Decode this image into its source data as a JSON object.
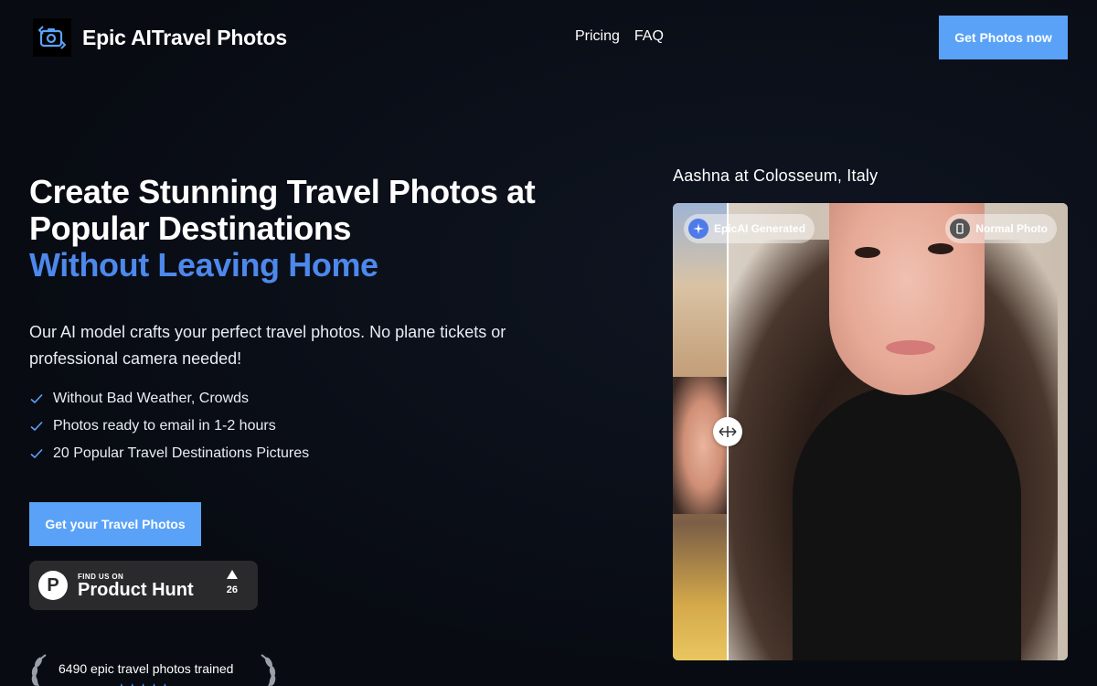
{
  "header": {
    "brand": "Epic AITravel Photos",
    "nav": [
      {
        "label": "Pricing"
      },
      {
        "label": "FAQ"
      }
    ],
    "cta_label": "Get Photos now"
  },
  "hero": {
    "title_line1": "Create Stunning Travel Photos at",
    "title_line2": "Popular Destinations",
    "title_accent": "Without Leaving Home",
    "lead": "Our AI model crafts your perfect travel photos. No plane tickets or professional camera needed!",
    "features": [
      {
        "label": "Without Bad Weather, Crowds"
      },
      {
        "label": "Photos ready to email in 1-2 hours"
      },
      {
        "label": "20 Popular Travel Destinations Pictures"
      }
    ],
    "cta_label": "Get your Travel Photos",
    "product_hunt": {
      "small": "FIND US ON",
      "big": "Product Hunt",
      "letter": "P",
      "votes": "26"
    },
    "trained_text": "6490 epic travel photos trained",
    "rating_stars": "★★★★★"
  },
  "showcase": {
    "caption": "Aashna at Colosseum, Italy",
    "badge_ai": "EpicAI Generated",
    "badge_normal": "Normal Photo"
  },
  "colors": {
    "accent": "#5aa2f7",
    "title_accent": "#4d88ec",
    "background": "#0b0f17"
  }
}
